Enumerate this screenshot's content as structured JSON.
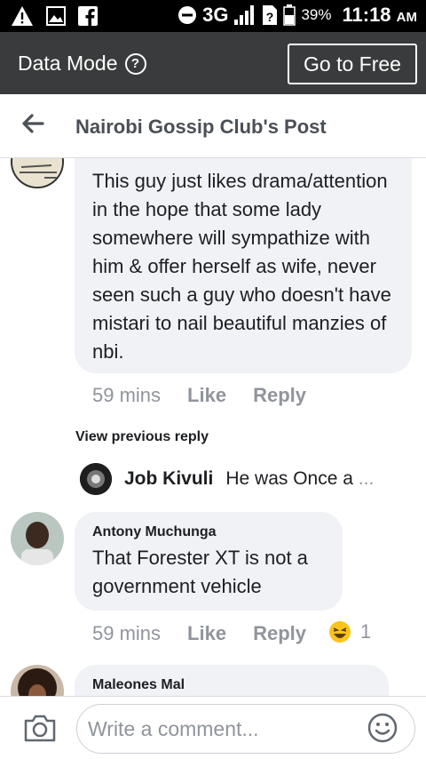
{
  "status_bar": {
    "network": "3G",
    "battery": "39%",
    "time": "11:18",
    "ampm": "AM",
    "icons": [
      "alert-icon",
      "gallery-icon",
      "facebook-icon",
      "dnd-icon",
      "signal-icon",
      "no-sim-icon",
      "battery-icon"
    ]
  },
  "data_mode": {
    "label": "Data Mode",
    "help_icon": "help-icon",
    "button": "Go to Free"
  },
  "header": {
    "title": "Nairobi Gossip Club's Post",
    "back_icon": "back-arrow-icon"
  },
  "comments": [
    {
      "author": "",
      "text": "This guy just likes drama/attention in the hope that some lady somewhere will sympathize with him & offer herself as wife, never seen such a guy who doesn't have mistari to nail beautiful manzies of nbi.",
      "time": "59 mins",
      "like": "Like",
      "reply": "Reply"
    },
    {
      "author": "Antony Muchunga",
      "text": "That Forester XT is not a government vehicle",
      "time": "59 mins",
      "like": "Like",
      "reply": "Reply",
      "reaction_count": "1",
      "reaction_icon": "haha-reaction-icon"
    },
    {
      "author": "Maleones Mal",
      "text": ""
    }
  ],
  "replies_preview": {
    "view_previous": "View previous reply",
    "author": "Job Kivuli",
    "text": "He was Once a",
    "ellipsis": "..."
  },
  "composer": {
    "placeholder": "Write a comment...",
    "camera_icon": "camera-icon",
    "emoji_icon": "emoji-icon"
  },
  "colors": {
    "status_bar_bg": "#000000",
    "data_mode_bg": "#3a3b3c",
    "bubble_bg": "#f0f2f5",
    "meta_text": "#90949c"
  }
}
